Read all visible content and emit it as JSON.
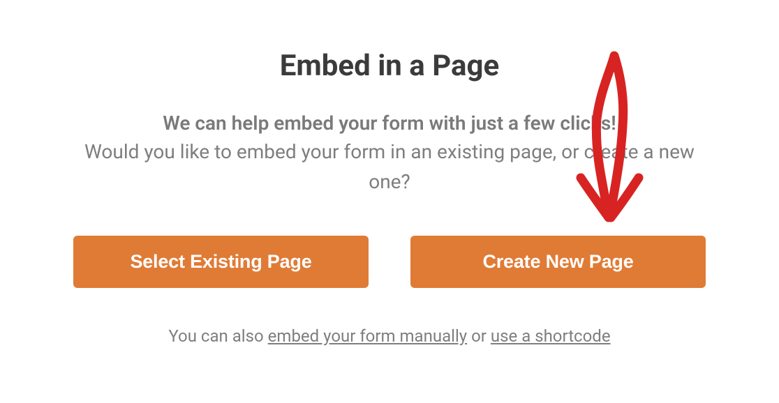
{
  "modal": {
    "title": "Embed in a Page",
    "lead": "We can help embed your form with just a few clicks!",
    "sub": "Would you like to embed your form in an existing page, or create a new one?",
    "buttons": {
      "select_existing": "Select Existing Page",
      "create_new": "Create New Page"
    },
    "footer": {
      "prefix": "You can also ",
      "link_manual": "embed your form manually",
      "middle": " or ",
      "link_shortcode": "use a shortcode"
    }
  },
  "annotation": {
    "arrow_color": "#d82323"
  }
}
